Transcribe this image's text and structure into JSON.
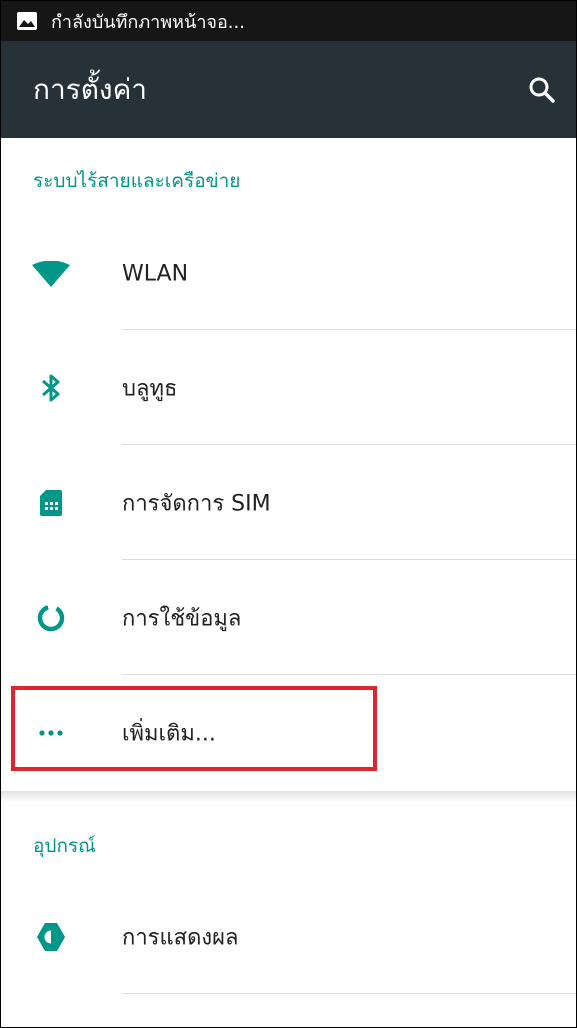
{
  "status_bar": {
    "icon": "image-icon",
    "text": "กำลังบันทึกภาพหน้าจอ..."
  },
  "toolbar": {
    "title": "การตั้งค่า",
    "search_icon": "search-icon"
  },
  "sections": [
    {
      "header": "ระบบไร้สายและเครือข่าย",
      "items": [
        {
          "label": "WLAN",
          "icon": "wifi-icon"
        },
        {
          "label": "บลูทูธ",
          "icon": "bluetooth-icon"
        },
        {
          "label": "การจัดการ SIM",
          "icon": "sim-card-icon"
        },
        {
          "label": "การใช้ข้อมูล",
          "icon": "data-usage-icon"
        },
        {
          "label": "เพิ่มเติม...",
          "icon": "more-icon"
        }
      ]
    },
    {
      "header": "อุปกรณ์",
      "items": [
        {
          "label": "การแสดงผล",
          "icon": "brightness-icon"
        }
      ]
    }
  ],
  "colors": {
    "accent": "#009688",
    "toolbar": "#263238",
    "status_bar": "#161616",
    "highlight": "#e0242a"
  }
}
